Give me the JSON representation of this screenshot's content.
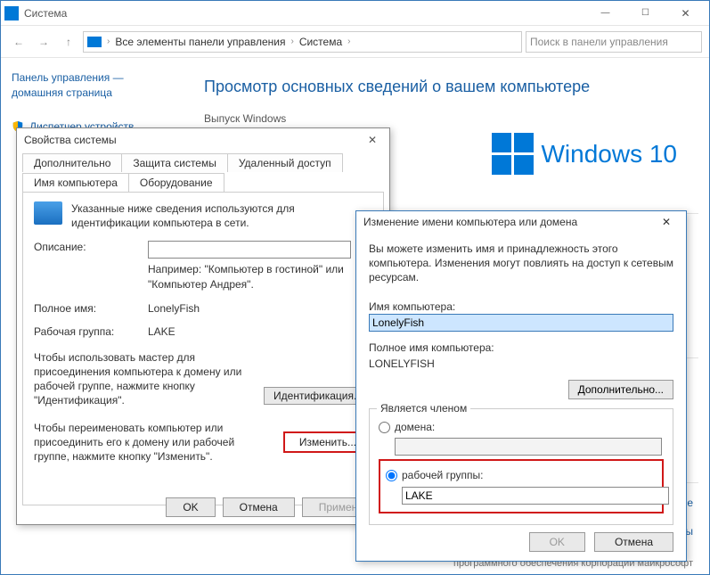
{
  "window": {
    "title": "Система",
    "search_placeholder": "Поиск в панели управления",
    "breadcrumbs": [
      "Все элементы панели управления",
      "Система"
    ]
  },
  "sidebar": {
    "cp_home": "Панель управления — домашняя страница",
    "device_manager": "Диспетчер устройств"
  },
  "main": {
    "heading": "Просмотр основных сведений о вашем компьютере",
    "edition_label": "Выпуск Windows",
    "logo_text": "Windows 10",
    "right_links": [
      "ние",
      "одукты"
    ],
    "footer": "программного обеспечения корпорации майкрософт"
  },
  "sysprops": {
    "title": "Свойства системы",
    "tabs_row1": [
      "Дополнительно",
      "Защита системы",
      "Удаленный доступ"
    ],
    "tabs_row2": [
      "Имя компьютера",
      "Оборудование"
    ],
    "active_tab": "Имя компьютера",
    "desc": "Указанные ниже сведения используются для идентификации компьютера в сети.",
    "fields": {
      "description_label": "Описание:",
      "description_value": "",
      "hint": "Например: \"Компьютер в гостиной\" или \"Компьютер Андрея\".",
      "fullname_label": "Полное имя:",
      "fullname_value": "LonelyFish",
      "workgroup_label": "Рабочая группа:",
      "workgroup_value": "LAKE"
    },
    "ident_text": "Чтобы использовать мастер для присоединения компьютера к домену или рабочей группе, нажмите кнопку \"Идентификация\".",
    "ident_btn": "Идентификация...",
    "change_text": "Чтобы переименовать компьютер или присоединить его к домену или рабочей группе, нажмите кнопку \"Изменить\".",
    "change_btn": "Изменить...",
    "ok": "OK",
    "cancel": "Отмена",
    "apply": "Примени"
  },
  "namedlg": {
    "title": "Изменение имени компьютера или домена",
    "intro": "Вы можете изменить имя и принадлежность этого компьютера. Изменения могут повлиять на доступ к сетевым ресурсам.",
    "name_label": "Имя компьютера:",
    "name_value": "LonelyFish",
    "full_label": "Полное имя компьютера:",
    "full_value": "LONELYFISH",
    "extra_btn": "Дополнительно...",
    "member_legend": "Является членом",
    "domain_label": "домена:",
    "domain_value": "",
    "workgroup_label": "рабочей группы:",
    "workgroup_value": "LAKE",
    "member_selected": "workgroup",
    "ok": "OK",
    "cancel": "Отмена"
  }
}
